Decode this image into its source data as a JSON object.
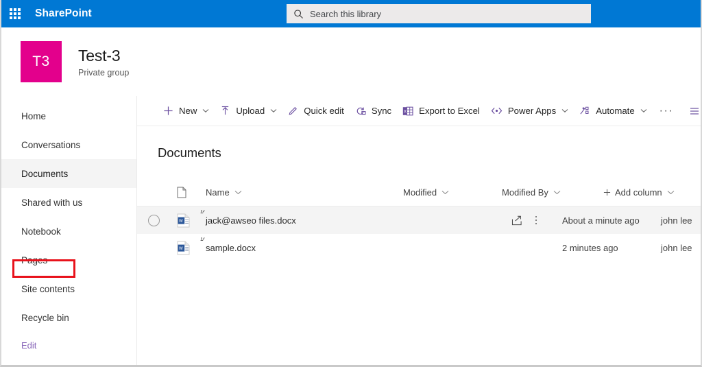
{
  "suite": {
    "waffle_label": "app-launcher",
    "brand": "SharePoint",
    "search_placeholder": "Search this library",
    "search_value": "",
    "header_color": "#0078d4"
  },
  "site": {
    "logo_initials": "T3",
    "logo_color": "#e3008c",
    "title": "Test-3",
    "subtitle": "Private group"
  },
  "sidebar": {
    "items": [
      {
        "label": "Home",
        "selected": false
      },
      {
        "label": "Conversations",
        "selected": false
      },
      {
        "label": "Documents",
        "selected": true
      },
      {
        "label": "Shared with us",
        "selected": false
      },
      {
        "label": "Notebook",
        "selected": false
      },
      {
        "label": "Pages",
        "selected": false
      },
      {
        "label": "Site contents",
        "selected": false
      },
      {
        "label": "Recycle bin",
        "selected": false
      }
    ],
    "edit_label": "Edit",
    "edit_color": "#8764b8",
    "highlight_color": "#e8121b",
    "highlighted_item": "Documents"
  },
  "toolbar": {
    "new_label": "New",
    "upload_label": "Upload",
    "quick_edit_label": "Quick edit",
    "sync_label": "Sync",
    "export_label": "Export to Excel",
    "power_apps_label": "Power Apps",
    "automate_label": "Automate",
    "overflow_label": "···",
    "icon_color": "#6b4fa0"
  },
  "list": {
    "title": "Documents",
    "columns": {
      "type": "file-type",
      "name": "Name",
      "modified": "Modified",
      "modified_by": "Modified By",
      "add_column": "Add column"
    },
    "rows": [
      {
        "name": "jack@awseo files.docx",
        "modified": "About a minute ago",
        "modified_by": "john lee",
        "file_type": "docx",
        "is_new": true,
        "hovered": true
      },
      {
        "name": "sample.docx",
        "modified": "2 minutes ago",
        "modified_by": "john lee",
        "file_type": "docx",
        "is_new": true,
        "hovered": false
      }
    ]
  }
}
